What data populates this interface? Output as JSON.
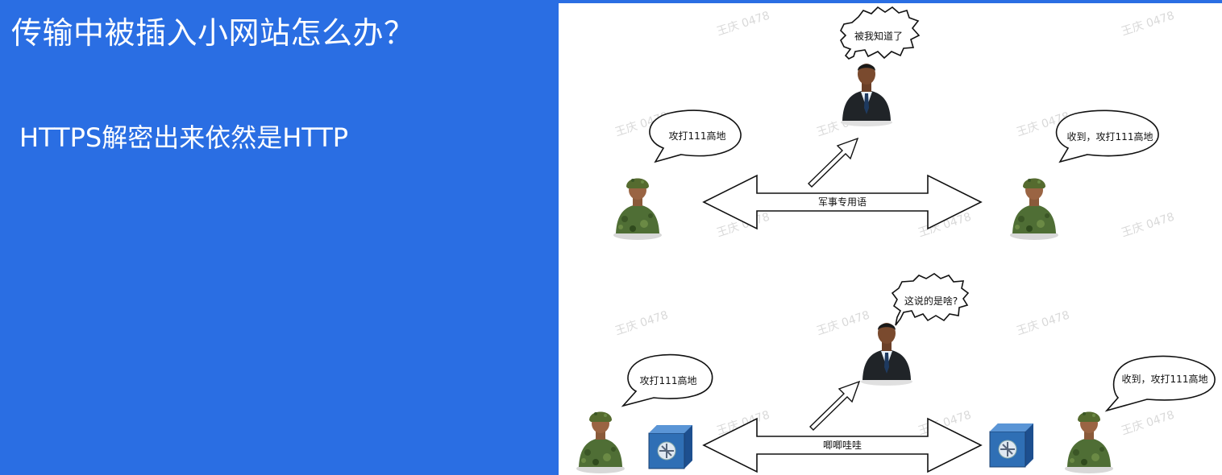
{
  "slide": {
    "title": "传输中被插入小网站怎么办？",
    "subtitle": "HTTPS解密出来依然是HTTP"
  },
  "diagram": {
    "watermark": "王庆 0478",
    "top": {
      "spy_speech": "被我知道了",
      "sender_speech": "攻打111高地",
      "receiver_speech": "收到，攻打111高地",
      "channel_label": "军事专用语"
    },
    "bottom": {
      "spy_speech": "这说的是啥?",
      "sender_speech": "攻打111高地",
      "receiver_speech": "收到，攻打111高地",
      "channel_label": "唧唧哇哇"
    }
  },
  "colors": {
    "slide_bg": "#2a6ee3",
    "panel_bg": "#ffffff",
    "uniform_green": "#4f6e35",
    "safe_blue": "#2f6fb5",
    "suit_dark": "#202428"
  }
}
